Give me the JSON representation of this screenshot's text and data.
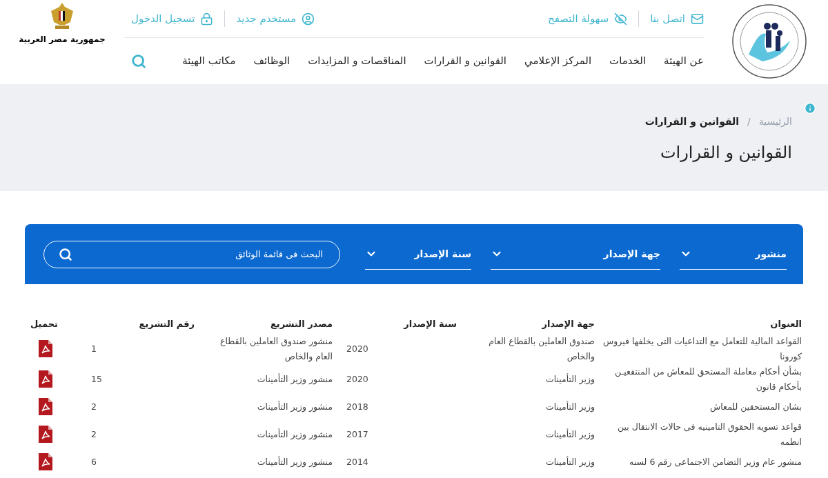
{
  "header": {
    "top_links": [
      {
        "kind": "mail",
        "label": "اتصل بنا"
      },
      {
        "kind": "accessibility",
        "label": "سهولة التصفح"
      },
      {
        "kind": "user",
        "label": "مستخدم جديد"
      },
      {
        "kind": "lock",
        "label": "تسجيل الدخول"
      }
    ],
    "nav": [
      "عن الهيئة",
      "الخدمات",
      "المركز الإعلامي",
      "القوانين و القرارات",
      "المناقصات و المزايدات",
      "الوظائف",
      "مكاتب الهيئة"
    ],
    "emblem_caption": "جمهورية مصر العربية"
  },
  "breadcrumb": {
    "items": [
      "الرئيسية",
      "القوانين و القرارات"
    ],
    "separator": "/"
  },
  "page_title": "القوانين و القرارات",
  "filters": {
    "dropdowns": [
      "منشور",
      "جهة الإصدار",
      "سنة الإصدار"
    ],
    "search": {
      "placeholder": "البحث فى قائمة الوثائق"
    }
  },
  "table": {
    "columns": [
      "العنوان",
      "جهة الإصدار",
      "سنة الإصدار",
      "مصدر التشريع",
      "رقم التشريع",
      "تحميل"
    ],
    "rows": [
      {
        "title": "القواعد المالية للتعامل مع التداعيات التى يخلفها فيروس كورونا",
        "issuer": "صندوق العاملين بالقطاع العام والخاص",
        "year": "2020",
        "source": "منشور صندوق العاملين بالقطاع العام والخاص",
        "number": "1"
      },
      {
        "title": "بشأن أحكام معاملة المستحق للمعاش من المنتفعيـن بأحكام قانون",
        "issuer": "وزير التأمينات",
        "year": "2020",
        "source": "منشور وزير التأمينات",
        "number": "15"
      },
      {
        "title": "بشان المستحقين للمعاش",
        "issuer": "وزير التأمينات",
        "year": "2018",
        "source": "منشور وزير التأمينات",
        "number": "2"
      },
      {
        "title": "قواعد تسويه الحقوق التامينيه فى حالات الانتقال بين انظمه",
        "issuer": "وزير التأمينات",
        "year": "2017",
        "source": "منشور وزير التأمينات",
        "number": "2"
      },
      {
        "title": "منشور عام وزير التضامن الاجتماعى رقم 6 لسنه",
        "issuer": "وزير التأمينات",
        "year": "2014",
        "source": "منشور وزير التأمينات",
        "number": "6"
      }
    ]
  }
}
